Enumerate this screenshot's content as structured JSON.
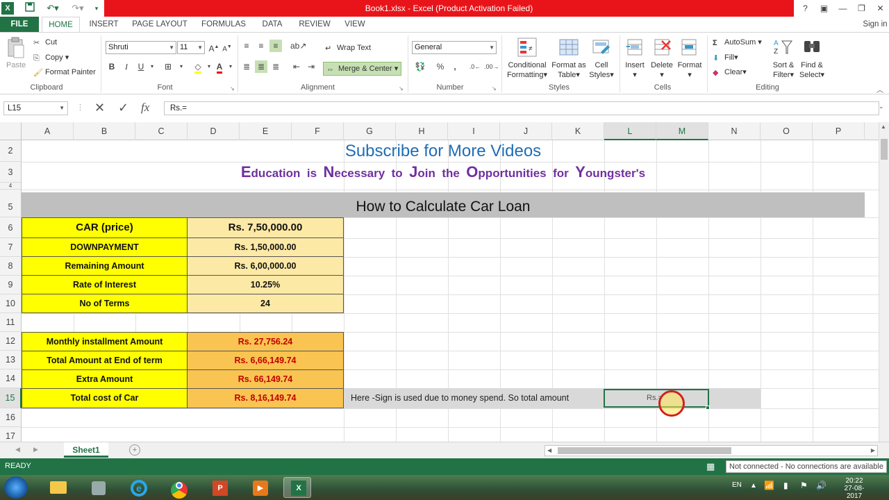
{
  "window": {
    "title": "Book1.xlsx - Excel (Product Activation Failed)",
    "help": "?",
    "signin": "Sign in"
  },
  "tabs": [
    "FILE",
    "HOME",
    "INSERT",
    "PAGE LAYOUT",
    "FORMULAS",
    "DATA",
    "REVIEW",
    "VIEW"
  ],
  "ribbon": {
    "clipboard": {
      "label": "Clipboard",
      "paste": "Paste",
      "cut": "Cut",
      "copy": "Copy",
      "format_painter": "Format Painter"
    },
    "font": {
      "label": "Font",
      "name": "Shruti",
      "size": "11"
    },
    "alignment": {
      "label": "Alignment",
      "wrap": "Wrap Text",
      "merge": "Merge & Center"
    },
    "number": {
      "label": "Number",
      "format": "General"
    },
    "styles": {
      "label": "Styles",
      "conditional": "Conditional",
      "conditional2": "Formatting",
      "format_as": "Format as",
      "format_as2": "Table",
      "cell_styles": "Cell",
      "cell_styles2": "Styles"
    },
    "cells": {
      "label": "Cells",
      "insert": "Insert",
      "delete": "Delete",
      "format": "Format"
    },
    "editing": {
      "label": "Editing",
      "autosum": "AutoSum",
      "fill": "Fill",
      "clear": "Clear",
      "sort": "Sort &",
      "sort2": "Filter",
      "find": "Find &",
      "find2": "Select"
    }
  },
  "formula_bar": {
    "name_box": "L15",
    "formula": "Rs.="
  },
  "columns": [
    "A",
    "B",
    "C",
    "D",
    "E",
    "F",
    "G",
    "H",
    "I",
    "J",
    "K",
    "L",
    "M",
    "N",
    "O",
    "P"
  ],
  "rows": [
    "2",
    "3",
    "4",
    "5",
    "6",
    "7",
    "8",
    "9",
    "10",
    "11",
    "12",
    "13",
    "14",
    "15",
    "16",
    "17"
  ],
  "sheet": {
    "subscribe": "Subscribe for More Videos",
    "education": [
      {
        "cap": "E",
        "rest": "ducation"
      },
      {
        "cap": "",
        "rest": "is"
      },
      {
        "cap": "N",
        "rest": "ecessary"
      },
      {
        "cap": "",
        "rest": "to"
      },
      {
        "cap": "J",
        "rest": "oin"
      },
      {
        "cap": "",
        "rest": "the"
      },
      {
        "cap": "O",
        "rest": "pportunities"
      },
      {
        "cap": "",
        "rest": "for"
      },
      {
        "cap": "Y",
        "rest": "oungster's"
      }
    ],
    "heading": "How to Calculate Car Loan",
    "table": [
      {
        "label": "CAR (price)",
        "value": "Rs. 7,50,000.00"
      },
      {
        "label": "DOWNPAYMENT",
        "value": "Rs. 1,50,000.00"
      },
      {
        "label": "Remaining Amount",
        "value": "Rs. 6,00,000.00"
      },
      {
        "label": "Rate of Interest",
        "value": "10.25%"
      },
      {
        "label": "No of Terms",
        "value": "24"
      }
    ],
    "results": [
      {
        "label": "Monthly installment Amount",
        "value": "Rs. 27,756.24"
      },
      {
        "label": "Total Amount at End of term",
        "value": "Rs. 6,66,149.74"
      },
      {
        "label": "Extra Amount",
        "value": "Rs. 66,149.74"
      },
      {
        "label": "Total cost of Car",
        "value": "Rs. 8,16,149.74"
      }
    ],
    "note": "Here -Sign is used due to money spend. So total amount",
    "editing_cell": "Rs.="
  },
  "sheet_tabs": [
    "Sheet1"
  ],
  "status": {
    "mode": "READY",
    "connection": "Not connected - No connections are available"
  },
  "taskbar": {
    "lang": "EN",
    "time": "20:22",
    "date": "27-08-2017"
  },
  "colors": {
    "excel_green": "#217346",
    "title_red": "#e8141a",
    "yellow": "#ffff00",
    "peach": "#fde9a6",
    "orange": "#f9c451",
    "subscribe_blue": "#1f6db5",
    "purple": "#7030a0"
  }
}
